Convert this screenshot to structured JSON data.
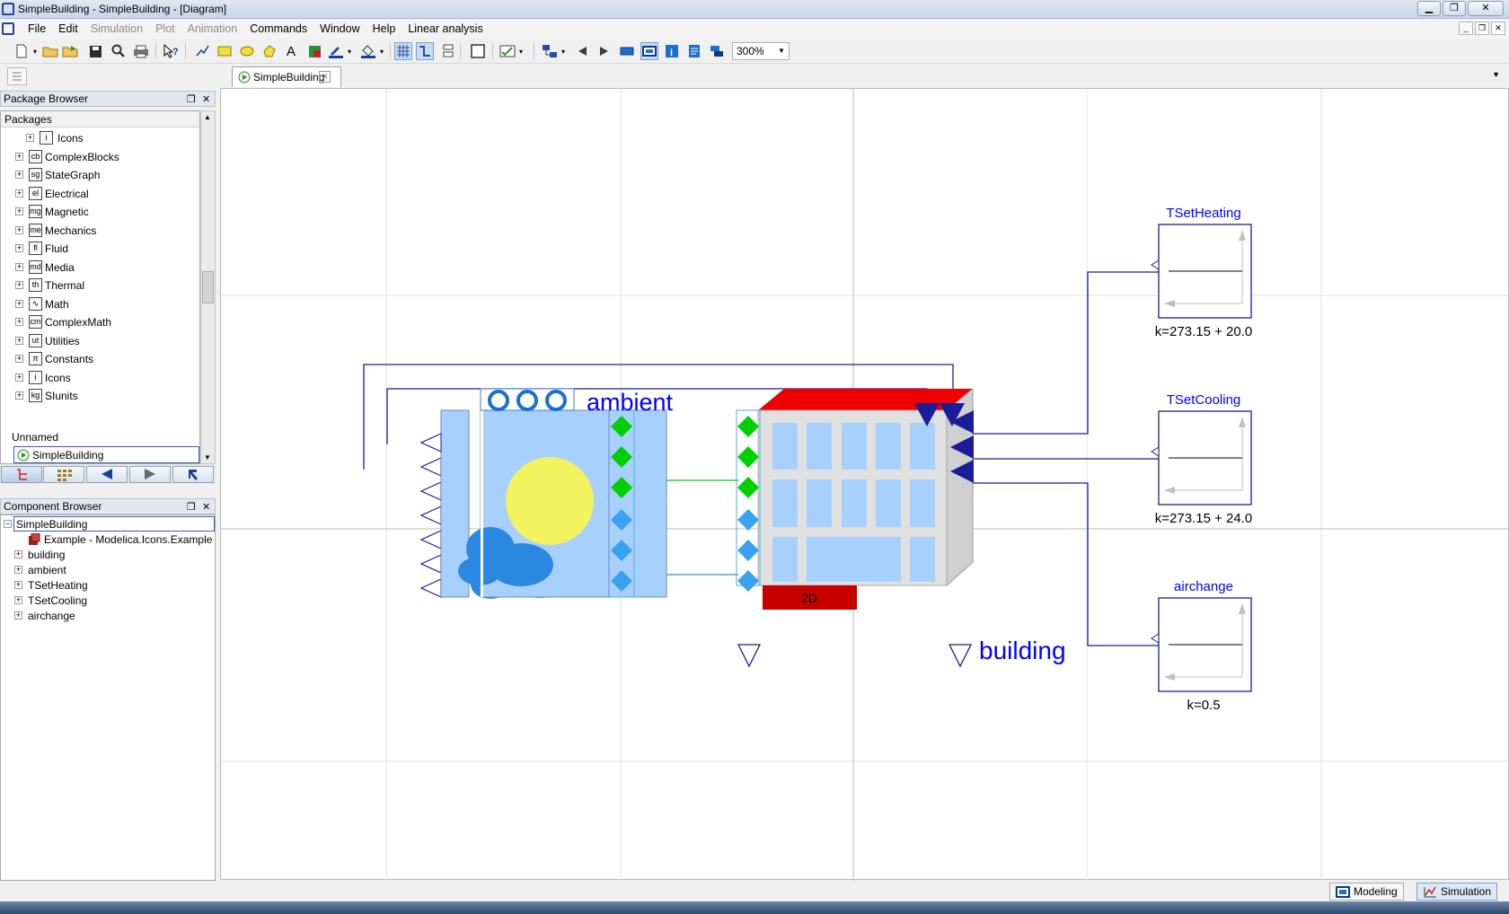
{
  "window": {
    "title": "SimpleBuilding - SimpleBuilding - [Diagram]"
  },
  "menu": [
    {
      "label": "File",
      "enabled": true
    },
    {
      "label": "Edit",
      "enabled": true
    },
    {
      "label": "Simulation",
      "enabled": false
    },
    {
      "label": "Plot",
      "enabled": false
    },
    {
      "label": "Animation",
      "enabled": false
    },
    {
      "label": "Commands",
      "enabled": true
    },
    {
      "label": "Window",
      "enabled": true
    },
    {
      "label": "Help",
      "enabled": true
    },
    {
      "label": "Linear analysis",
      "enabled": true
    }
  ],
  "toolbar": {
    "zoom": "300%"
  },
  "doc_tab": {
    "label": "SimpleBuilding"
  },
  "package_browser": {
    "title": "Package Browser",
    "column_header": "Packages",
    "items": [
      {
        "label": "Icons",
        "icon": "i",
        "level": 2
      },
      {
        "label": "ComplexBlocks",
        "icon": "cb",
        "level": 1
      },
      {
        "label": "StateGraph",
        "icon": "sg",
        "level": 1
      },
      {
        "label": "Electrical",
        "icon": "el",
        "level": 1
      },
      {
        "label": "Magnetic",
        "icon": "mg",
        "level": 1
      },
      {
        "label": "Mechanics",
        "icon": "me",
        "level": 1
      },
      {
        "label": "Fluid",
        "icon": "fl",
        "level": 1
      },
      {
        "label": "Media",
        "icon": "md",
        "level": 1
      },
      {
        "label": "Thermal",
        "icon": "th",
        "level": 1
      },
      {
        "label": "Math",
        "icon": "∿",
        "level": 1
      },
      {
        "label": "ComplexMath",
        "icon": "cm",
        "level": 1
      },
      {
        "label": "Utilities",
        "icon": "ut",
        "level": 1
      },
      {
        "label": "Constants",
        "icon": "π",
        "level": 1
      },
      {
        "label": "Icons",
        "icon": "i",
        "level": 1
      },
      {
        "label": "SIunits",
        "icon": "kg",
        "level": 1
      }
    ],
    "unnamed_label": "Unnamed",
    "selected_item": "SimpleBuilding"
  },
  "component_browser": {
    "title": "Component Browser",
    "root": "SimpleBuilding",
    "extends": "Example - Modelica.Icons.Example",
    "items": [
      "building",
      "ambient",
      "TSetHeating",
      "TSetCooling",
      "airchange"
    ]
  },
  "diagram": {
    "ambient_label": "ambient",
    "building_label": "building",
    "building_badge": "2D",
    "blocks": [
      {
        "name": "TSetHeating",
        "param": "k=273.15 + 20.0"
      },
      {
        "name": "TSetCooling",
        "param": "k=273.15 + 24.0"
      },
      {
        "name": "airchange",
        "param": "k=0.5"
      }
    ]
  },
  "mode_buttons": [
    {
      "label": "Modeling",
      "active": false
    },
    {
      "label": "Simulation",
      "active": true
    }
  ]
}
